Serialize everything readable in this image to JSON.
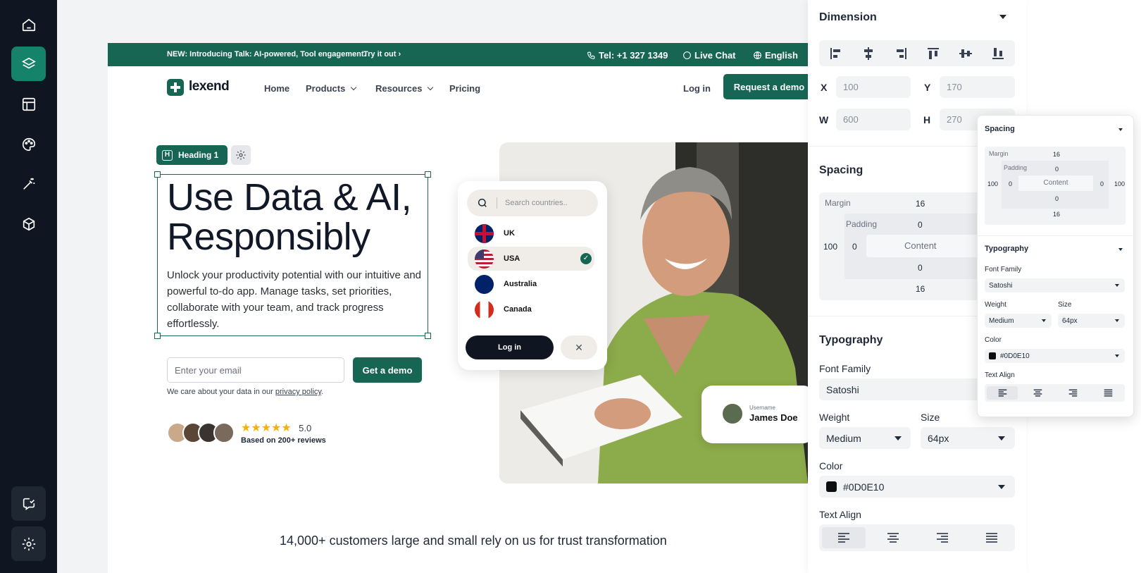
{
  "sidebar": {
    "items": [
      "home-icon",
      "layers-icon",
      "layout-icon",
      "palette-icon",
      "magic-wand-icon",
      "cube-icon"
    ],
    "bottom": [
      "feedback-icon",
      "settings-icon"
    ],
    "accent": "#15826a"
  },
  "site": {
    "announcement": "NEW: Introducing Talk: AI-powered, Tool engagement.",
    "try_it": "Try it out",
    "phone": "Tel: +1 327 1349",
    "live_chat": "Live Chat",
    "language": "English",
    "logo": "lexend",
    "nav": {
      "home": "Home",
      "products": "Products",
      "resources": "Resources",
      "pricing": "Pricing",
      "login": "Log in",
      "demo": "Request a demo"
    },
    "selection_label": "Heading 1",
    "headline_line1": "Use Data & AI,",
    "headline_line2": "Responsibly",
    "description": "Unlock your productivity potential with our intuitive and powerful to-do app. Manage tasks, set priorities, collaborate with your team, and track progress effortlessly.",
    "email_placeholder": "Enter your email",
    "get_demo": "Get a demo",
    "privacy_prefix": "We care about your data in our",
    "privacy_link": "privacy policy",
    "rating": "5.0",
    "reviews": "Based on 200+ reviews",
    "customers": "14,000+ customers large and small rely on us for trust transformation",
    "brand_color": "#176653"
  },
  "country_card": {
    "search_placeholder": "Search countries..",
    "countries": [
      "UK",
      "USA",
      "Australia",
      "Canada"
    ],
    "selected": "USA",
    "login": "Log in"
  },
  "user_card": {
    "label": "Username",
    "name": "James Doe"
  },
  "panel": {
    "dimension_title": "Dimension",
    "x_label": "X",
    "x_value": "100",
    "y_label": "Y",
    "y_value": "170",
    "w_label": "W",
    "w_value": "600",
    "h_label": "H",
    "h_value": "270",
    "spacing_title": "Spacing",
    "margin_label": "Margin",
    "margin_top": "16",
    "margin_left": "100",
    "margin_bottom": "16",
    "padding_label": "Padding",
    "padding_top": "0",
    "padding_left": "0",
    "padding_bottom": "0",
    "content_label": "Content",
    "typography_title": "Typography",
    "font_family_label": "Font Family",
    "font_family": "Satoshi",
    "weight_label": "Weight",
    "weight": "Medium",
    "size_label": "Size",
    "size": "64px",
    "color_label": "Color",
    "color_value": "#0D0E10",
    "text_align_label": "Text Align"
  },
  "float_panel": {
    "spacing_title": "Spacing",
    "margin_label": "Margin",
    "margin_top": "16",
    "margin_left": "100",
    "margin_right": "100",
    "margin_bottom": "16",
    "padding_label": "Padding",
    "padding_top": "0",
    "padding_left": "0",
    "padding_right": "0",
    "padding_bottom": "0",
    "content_label": "Content",
    "typography_title": "Typography",
    "font_family_label": "Font Family",
    "font_family": "Satoshi",
    "weight_label": "Weight",
    "weight": "Medium",
    "size_label": "Size",
    "size": "64px",
    "color_label": "Color",
    "color_value": "#0D0E10",
    "text_align_label": "Text Align"
  }
}
